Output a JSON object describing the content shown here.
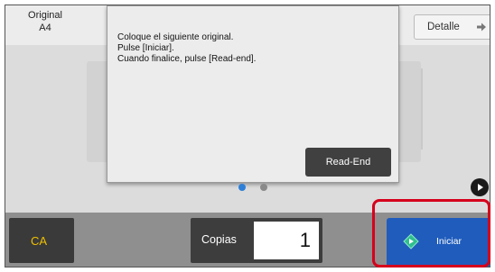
{
  "header": {
    "original_label": "Original",
    "original_size": "A4",
    "detail_label": "Detalle"
  },
  "dialog": {
    "lines": [
      "Coloque el siguiente original.",
      "Pulse [Iniciar].",
      "Cuando finalice, pulse [Read-end]."
    ],
    "read_end_label": "Read-End"
  },
  "bottom": {
    "ca_label": "CA",
    "copies_label": "Copias",
    "copies_value": "1",
    "start_label": "Iniciar"
  },
  "colors": {
    "start_button": "#1f5cbc",
    "highlight_frame": "#d6001c",
    "ca_text": "#f0c000",
    "page_dot_active": "#2e7fd8",
    "page_dot_inactive": "#8a8a8a"
  },
  "icons": {
    "detail": "arrow-right-icon",
    "next_page": "play-circle-icon",
    "start": "diamond-start-icon"
  },
  "pager": {
    "current": 1,
    "total": 2
  }
}
